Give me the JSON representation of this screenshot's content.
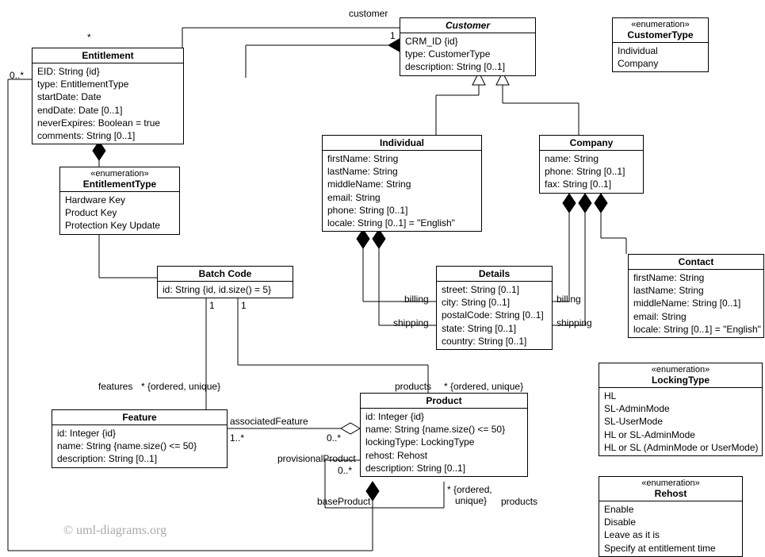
{
  "watermark": "© uml-diagrams.org",
  "labels": {
    "customer": "customer",
    "one_a": "1",
    "star_a": "*",
    "zero_many": "0..*",
    "billing_l": "billing",
    "shipping_l": "shipping",
    "billing_r": "billing",
    "shipping_r": "shipping",
    "one_b": "1",
    "one_c": "1",
    "features": "features",
    "ordered1": "* {ordered, unique}",
    "products": "products",
    "ordered2": "* {ordered, unique}",
    "assocFeature": "associatedFeature",
    "one_many": "1..*",
    "zero_many2": "0..*",
    "provisional": "provisionalProduct",
    "zero_many3": "0..*",
    "baseProduct": "baseProduct",
    "ordered3": "* {ordered,\n   unique}",
    "products2": "products"
  },
  "classes": {
    "entitlement": {
      "name": "Entitlement",
      "attrs": [
        "EID: String {id}",
        "type: EntitlementType",
        "startDate: Date",
        "endDate: Date [0..1]",
        "neverExpires: Boolean = true",
        "comments: String [0..1]"
      ]
    },
    "entitlementType": {
      "stereo": "«enumeration»",
      "name": "EntitlementType",
      "attrs": [
        "Hardware Key",
        "Product Key",
        "Protection Key Update"
      ]
    },
    "customer": {
      "name": "Customer",
      "attrs": [
        "CRM_ID {id}",
        "type: CustomerType",
        "description: String [0..1]"
      ]
    },
    "customerType": {
      "stereo": "«enumeration»",
      "name": "CustomerType",
      "attrs": [
        "Individual",
        "Company"
      ]
    },
    "individual": {
      "name": "Individual",
      "attrs": [
        "firstName: String",
        "lastName: String",
        "middleName: String",
        "email: String",
        "phone: String [0..1]",
        "locale: String [0..1] = \"English\""
      ]
    },
    "company": {
      "name": "Company",
      "attrs": [
        "name: String",
        "phone: String [0..1]",
        "fax: String [0..1]"
      ]
    },
    "details": {
      "name": "Details",
      "attrs": [
        "street: String [0..1]",
        "city: String [0..1]",
        "postalCode: String [0..1]",
        "state: String [0..1]",
        "country: String [0..1]"
      ]
    },
    "contact": {
      "name": "Contact",
      "attrs": [
        "firstName: String",
        "lastName: String",
        "middleName: String [0..1]",
        "email: String",
        "locale: String [0..1] = \"English\""
      ]
    },
    "batchCode": {
      "name": "Batch Code",
      "attrs": [
        "id: String {id, id.size() = 5}"
      ]
    },
    "feature": {
      "name": "Feature",
      "attrs": [
        "id: Integer {id}",
        "name: String {name.size() <= 50}",
        "description: String [0..1]"
      ]
    },
    "product": {
      "name": "Product",
      "attrs": [
        "id: Integer {id}",
        "name: String {name.size() <= 50}",
        "lockingType: LockingType",
        "rehost: Rehost",
        "description: String [0..1]"
      ]
    },
    "lockingType": {
      "stereo": "«enumeration»",
      "name": "LockingType",
      "attrs": [
        "HL",
        "SL-AdminMode",
        "SL-UserMode",
        "HL or SL-AdminMode",
        "HL or SL (AdminMode or UserMode)"
      ]
    },
    "rehost": {
      "stereo": "«enumeration»",
      "name": "Rehost",
      "attrs": [
        "Enable",
        "Disable",
        "Leave as it is",
        "Specify at entitlement time"
      ]
    }
  }
}
